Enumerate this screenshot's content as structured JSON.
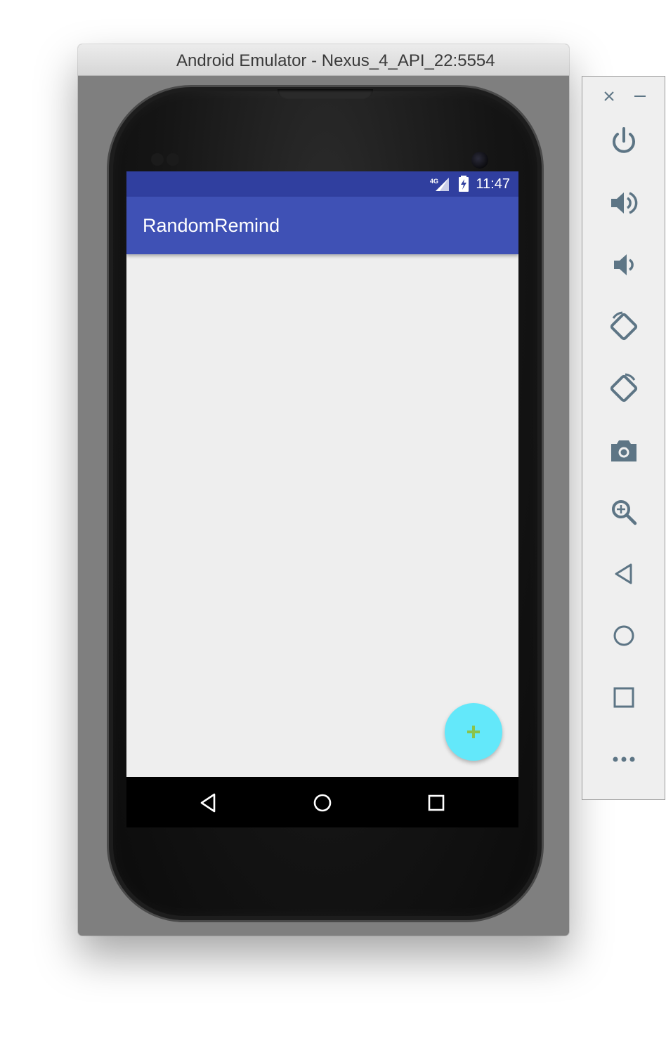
{
  "window": {
    "title": "Android Emulator - Nexus_4_API_22:5554"
  },
  "phone": {
    "status_bar": {
      "network": "4G",
      "time": "11:47",
      "icons": [
        "signal-4g-icon",
        "battery-charging-icon"
      ]
    },
    "app_bar": {
      "title": "RandomRemind"
    },
    "fab": {
      "icon": "plus-icon",
      "color": "#63e8fa",
      "icon_color": "#8bc34a"
    },
    "nav_bar": {
      "items": [
        "back-icon",
        "home-icon",
        "recents-icon"
      ]
    },
    "colors": {
      "status_bar": "#303f9f",
      "app_bar": "#3f51b5",
      "content_bg": "#eeeeee"
    }
  },
  "side_panel": {
    "controls": [
      "close-icon",
      "minimize-icon",
      "power-icon",
      "volume-up-icon",
      "volume-down-icon",
      "rotate-left-icon",
      "rotate-right-icon",
      "camera-icon",
      "zoom-icon",
      "back-icon",
      "home-icon",
      "overview-icon",
      "more-icon"
    ],
    "icon_color": "#5d7585"
  }
}
